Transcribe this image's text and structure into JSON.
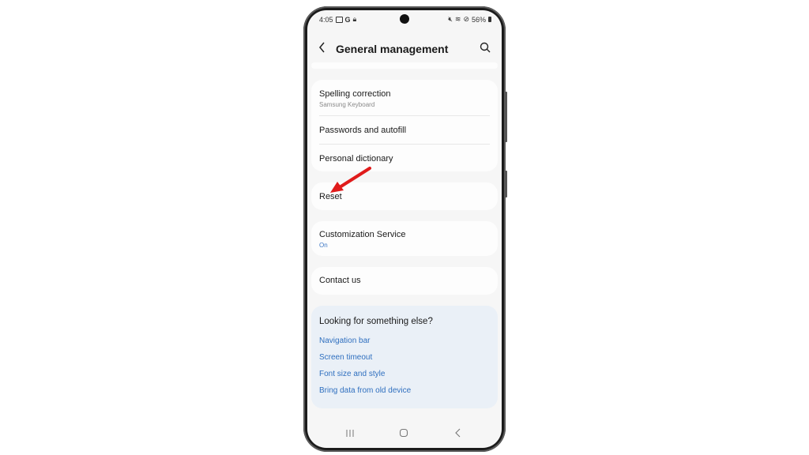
{
  "status_bar": {
    "time": "4:05",
    "battery": "56%"
  },
  "header": {
    "title": "General management"
  },
  "settings_groups": [
    {
      "items": [
        {
          "label": "Spelling correction",
          "sub": "Samsung Keyboard"
        },
        {
          "label": "Passwords and autofill"
        },
        {
          "label": "Personal dictionary"
        }
      ]
    },
    {
      "items": [
        {
          "label": "Reset"
        }
      ]
    },
    {
      "items": [
        {
          "label": "Customization Service",
          "sub": "On"
        }
      ]
    },
    {
      "items": [
        {
          "label": "Contact us"
        }
      ]
    }
  ],
  "suggestions": {
    "title": "Looking for something else?",
    "links": [
      "Navigation bar",
      "Screen timeout",
      "Font size and style",
      "Bring data from old device"
    ]
  },
  "colors": {
    "link": "#2f6fbf",
    "annotation_arrow": "#e01b1b"
  }
}
